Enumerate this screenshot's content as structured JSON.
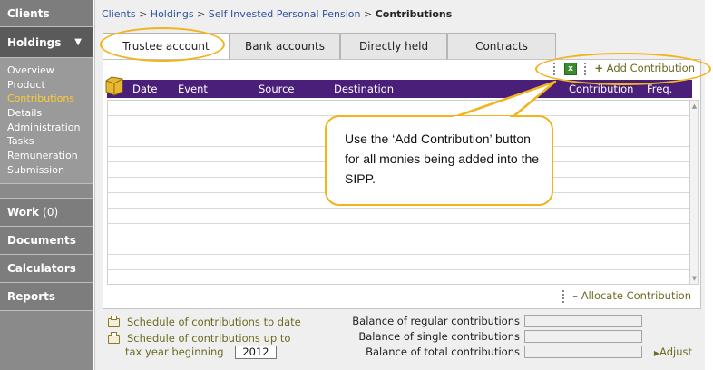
{
  "sidebar": {
    "clients": "Clients",
    "holdings": "Holdings",
    "holdings_chevron": "▼",
    "submenu": [
      "Overview",
      "Product",
      "Contributions",
      "Details",
      "Administration",
      "Tasks",
      "Remuneration",
      "Submission"
    ],
    "work": "Work",
    "work_count": "(0)",
    "documents": "Documents",
    "calculators": "Calculators",
    "reports": "Reports"
  },
  "breadcrumb": {
    "items": [
      "Clients",
      "Holdings",
      "Self Invested Personal Pension"
    ],
    "separator": ">",
    "current": "Contributions"
  },
  "tabs": [
    "Trustee account",
    "Bank accounts",
    "Directly held",
    "Contracts"
  ],
  "toolbar": {
    "excel_icon_text": "x",
    "add_contribution": "Add Contribution",
    "add_symbol": "+"
  },
  "table": {
    "columns": [
      "Date",
      "Event",
      "Source",
      "Destination",
      "Contribution",
      "Freq."
    ],
    "rows": []
  },
  "allocate": {
    "symbol": "–",
    "label": "Allocate Contribution"
  },
  "footer": {
    "schedule_to_date": "Schedule of contributions to date",
    "schedule_up_to_line1": "Schedule of contributions up to",
    "schedule_up_to_line2": "tax year beginning",
    "tax_year": "2012",
    "balance_regular": "Balance of regular contributions",
    "balance_single": "Balance of single contributions",
    "balance_total": "Balance of total contributions",
    "adjust": "Adjust",
    "adjust_symbol": "▶"
  },
  "callout": {
    "text": "Use the ‘Add Contribution’ button for all monies being added into the SIPP."
  },
  "colors": {
    "header_purple": "#4a1f7a",
    "highlight_orange": "#f2b31b",
    "link_olive": "#6b6b22",
    "sidebar_current": "#ffcc33"
  }
}
